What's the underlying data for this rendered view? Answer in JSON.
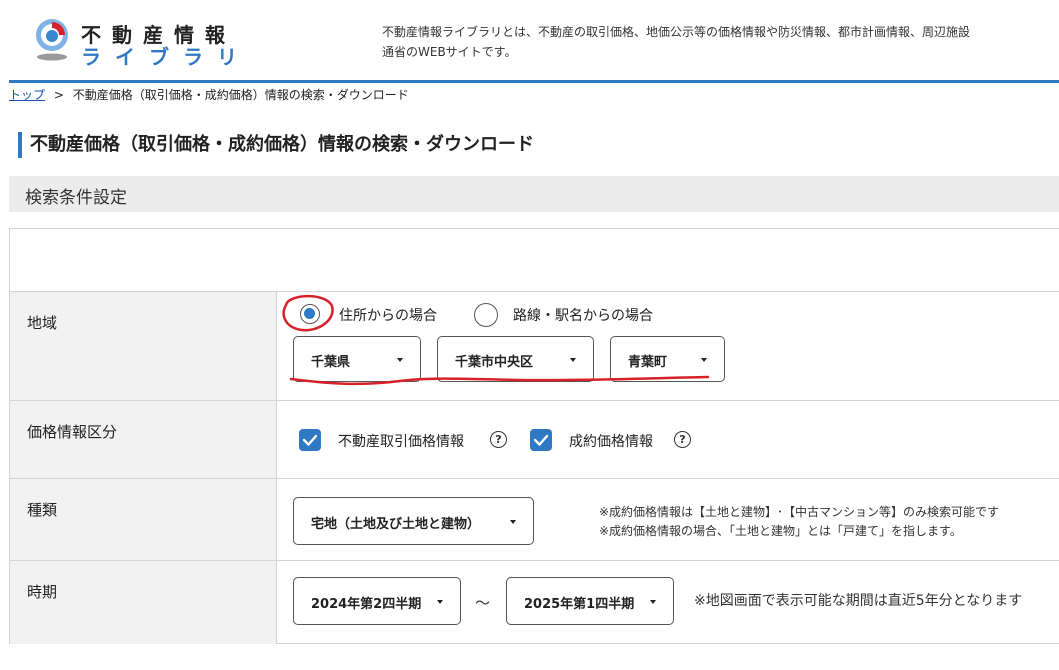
{
  "header": {
    "logo_top": "不動産情報",
    "logo_bottom": "ライブラリ",
    "desc_line1": "不動産情報ライブラリとは、不動産の取引価格、地価公示等の価格情報や防災情報、都市計画情報、周辺施設",
    "desc_line2": "通省のWEBサイトです。"
  },
  "breadcrumb": {
    "home": "トップ",
    "separator": ">",
    "current": "不動産価格（取引価格・成約価格）情報の検索・ダウンロード"
  },
  "page_title": "不動産価格（取引価格・成約価格）情報の検索・ダウンロード",
  "section_title": "検索条件設定",
  "form": {
    "region": {
      "label": "地域",
      "radio_address": "住所からの場合",
      "radio_station": "路線・駅名からの場合",
      "selected": "address",
      "prefecture": "千葉県",
      "city": "千葉市中央区",
      "district": "青葉町"
    },
    "price_category": {
      "label": "価格情報区分",
      "transaction": "不動産取引価格情報",
      "contract": "成約価格情報",
      "transaction_checked": true,
      "contract_checked": true
    },
    "type": {
      "label": "種類",
      "value": "宅地（土地及び土地と建物）",
      "note1": "※成約価格情報は【土地と建物】･【中古マンション等】のみ検索可能です",
      "note2": "※成約価格情報の場合、「土地と建物」とは「戸建て」を指します。"
    },
    "period": {
      "label": "時期",
      "from": "2024年第2四半期",
      "tilde": "～",
      "to": "2025年第1四半期",
      "note": "※地図画面で表示可能な期間は直近5年分となります"
    }
  },
  "colors": {
    "accent": "#2f78c4",
    "annotation": "#d8202a"
  },
  "icons": {
    "help": "?"
  }
}
